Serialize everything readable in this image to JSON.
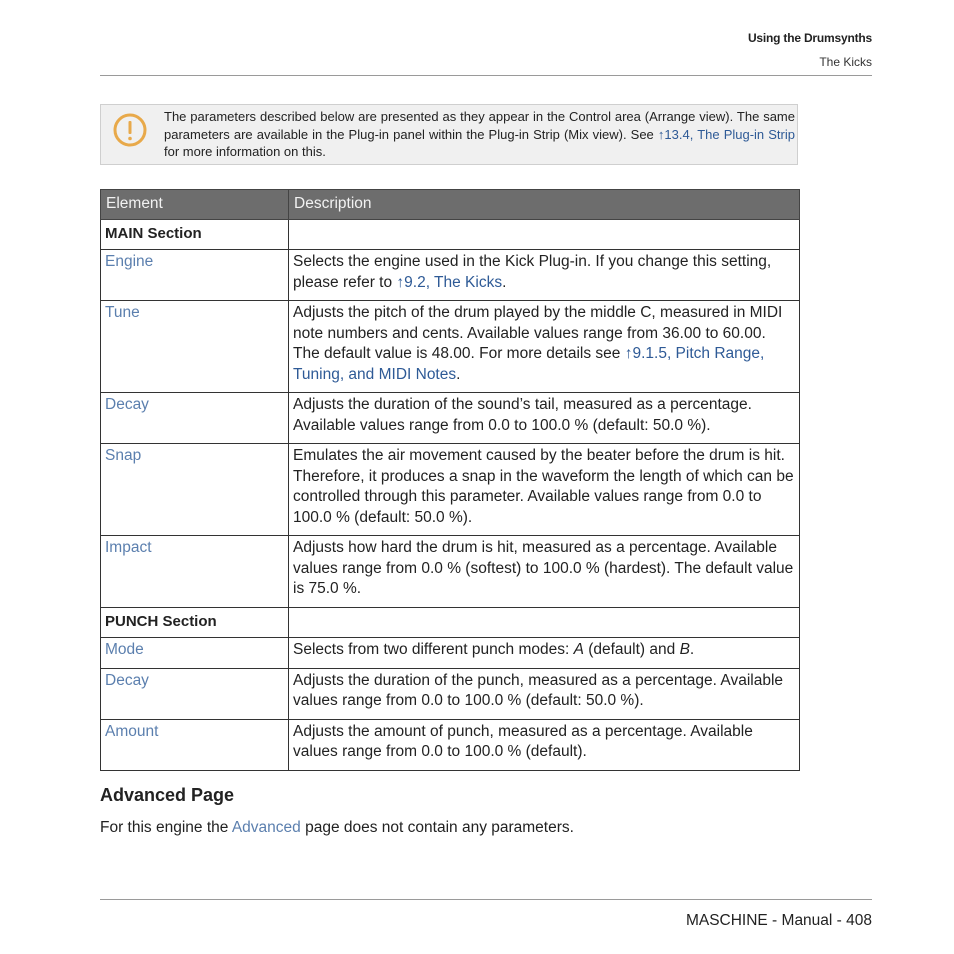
{
  "header": {
    "chapter": "Using the Drumsynths",
    "section": "The Kicks"
  },
  "note": {
    "icon": "exclamation-circle-icon",
    "icon_color": "#e8a94a",
    "text_before": "The parameters described below are presented as they appear in the Control area (Arrange view). The same parameters are available in the Plug-in panel within the Plug-in Strip (Mix view). See ",
    "link_text": "↑13.4, The Plug-in Strip",
    "text_after": " for more information on this."
  },
  "table": {
    "headers": [
      "Element",
      "Description"
    ],
    "main_section": "MAIN Section",
    "punch_section": "PUNCH Section",
    "rows": {
      "engine": {
        "element": "Engine",
        "desc_before": "Selects the engine used in the Kick Plug-in. If you change this setting, please refer to ",
        "link": "↑9.2, The Kicks",
        "desc_after": "."
      },
      "tune": {
        "element": "Tune",
        "desc_before": "Adjusts the pitch of the drum played by the middle C, measured in MIDI note numbers and cents. Available values range from 36.00 to 60.00. The default value is 48.00. For more details see ",
        "link": "↑9.1.5, Pitch Range, Tuning, and MIDI Notes",
        "desc_after": "."
      },
      "decay": {
        "element": "Decay",
        "desc": "Adjusts the duration of the sound’s tail, measured as a percentage. Available values range from 0.0 to 100.0 % (default: 50.0 %)."
      },
      "snap": {
        "element": "Snap",
        "desc": "Emulates the air movement caused by the beater before the drum is hit. Therefore, it produces a snap in the waveform the length of which can be controlled through this parameter. Available values range from 0.0 to 100.0 % (default: 50.0 %)."
      },
      "impact": {
        "element": "Impact",
        "desc": "Adjusts how hard the drum is hit, measured as a percentage. Available values range from 0.0 % (softest) to 100.0 % (hardest). The default value is 75.0 %."
      },
      "mode": {
        "element": "Mode",
        "desc_before": "Selects from two different punch modes: ",
        "option_a": "A",
        "desc_mid": " (default) and ",
        "option_b": "B",
        "desc_after": "."
      },
      "punch_decay": {
        "element": "Decay",
        "desc": "Adjusts the duration of the punch, measured as a percentage. Available values range from 0.0 to 100.0 % (default: 50.0 %)."
      },
      "amount": {
        "element": "Amount",
        "desc": "Adjusts the amount of punch, measured as a percentage. Available values range from 0.0 to 100.0 % (default)."
      }
    }
  },
  "advanced": {
    "heading": "Advanced Page",
    "text_before": "For this engine the ",
    "link": "Advanced",
    "text_after": " page does not contain any parameters."
  },
  "footer": {
    "text": "MASCHINE - Manual - 408"
  }
}
